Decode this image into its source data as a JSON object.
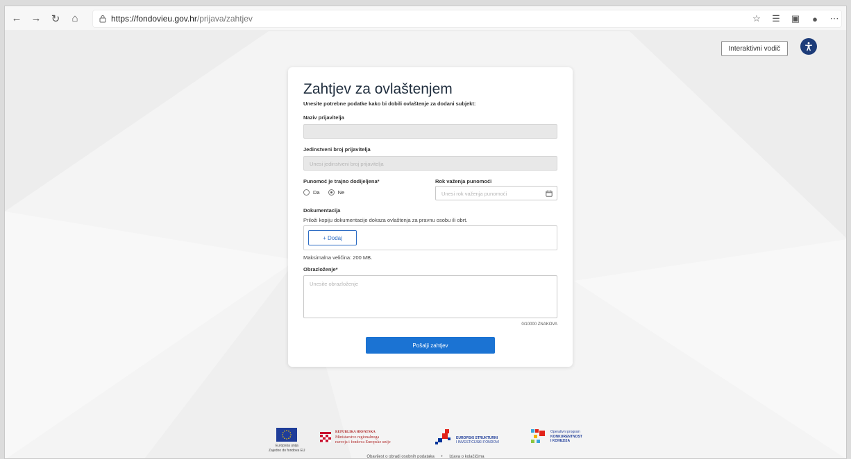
{
  "browser": {
    "url_host": "https://fondovieu.gov.hr",
    "url_path": "/prijava/zahtjev"
  },
  "header": {
    "guide_label": "Interaktivni vodič"
  },
  "form": {
    "title": "Zahtjev za ovlaštenjem",
    "subtitle": "Unesite potrebne podatke kako bi dobili ovlaštenje za dodani subjekt:",
    "applicant_name_label": "Naziv prijavitelja",
    "applicant_name_value": "",
    "applicant_id_label": "Jedinstveni broj prijavitelja",
    "applicant_id_placeholder": "Unesi jedinstveni broj prijavitelja",
    "permanent_label": "Punomoć je trajno dodijeljena*",
    "option_yes": "Da",
    "option_no": "Ne",
    "selected_option": "Ne",
    "validity_label": "Rok važenja punomoći",
    "validity_placeholder": "Unesi rok važenja punomoći",
    "docs_label": "Dokumentacija",
    "docs_help": "Priloži kopiju dokumentacije dokaza ovlaštenja za pravnu osobu ili obrt.",
    "add_label": "+ Dodaj",
    "max_size": "Maksimalna veličina: 200 MB.",
    "reason_label": "Obrazloženje*",
    "reason_placeholder": "Unesite obrazloženje",
    "counter": "0/10000 ZNAKOVA",
    "submit_label": "Pošalji zahtjev"
  },
  "footer": {
    "eu_text": "Europska unija\nZajedno do fondova EU",
    "ministry_line1": "REPUBLIKA HRVATSKA",
    "ministry_line2": "Ministarstvo regionalnoga",
    "ministry_line3": "razvoja i fondova Europske unije",
    "esif_line1": "EUROPSKI STRUKTURNI",
    "esif_line2": "I INVESTICIJSKI FONDOVI",
    "op_line1": "Operativni program",
    "op_line2": "KONKURENTNOST",
    "op_line3": "I KOHEZIJA",
    "link_privacy": "Obavijest o obradi osobnih podataka",
    "link_separator": "•",
    "link_cookies": "Izjava o kolačićima"
  },
  "colors": {
    "primary": "#1b73d3",
    "accessibility": "#1d3c79"
  }
}
